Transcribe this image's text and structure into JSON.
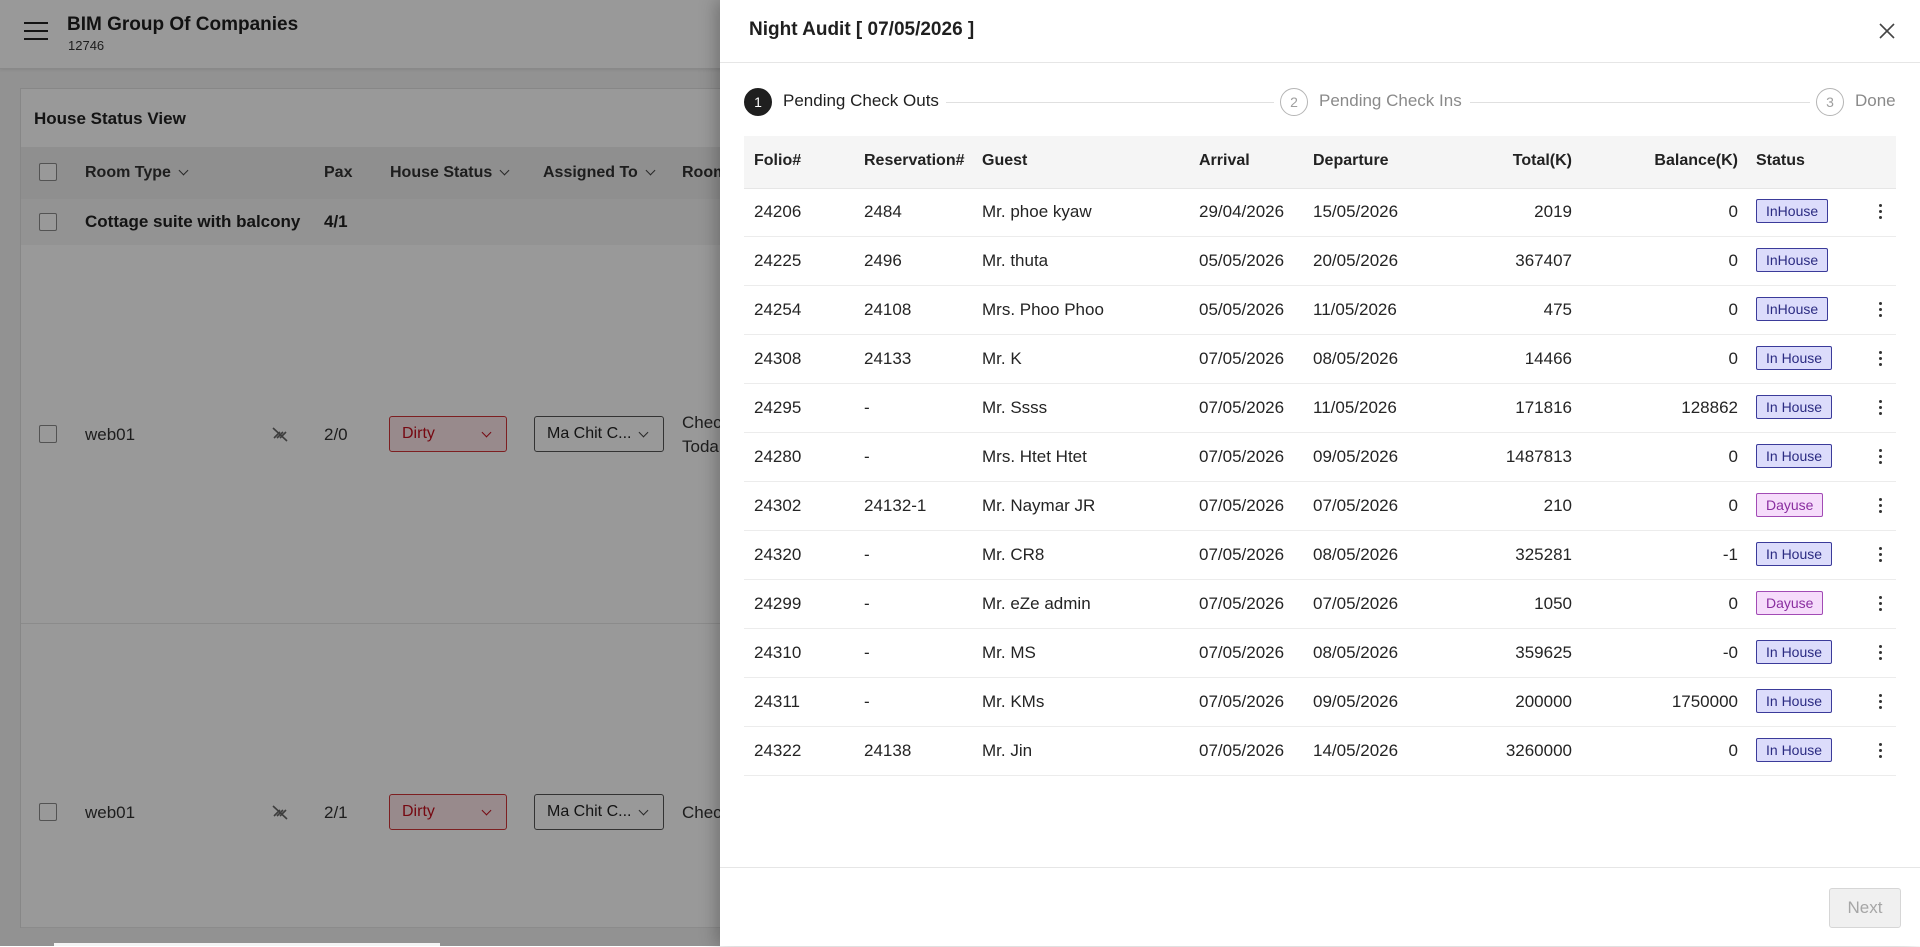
{
  "background_app": {
    "company_name": "BIM Group Of Companies",
    "company_code": "12746",
    "panel_title": "House Status View",
    "columns": {
      "room_type": "Room Type",
      "pax": "Pax",
      "house_status": "House Status",
      "assigned_to": "Assigned To",
      "room": "Room"
    },
    "group": {
      "room_type": "Cottage suite with balcony",
      "pax": "4/1"
    },
    "rows": [
      {
        "room": "web01",
        "pax": "2/0",
        "status": "Dirty",
        "assigned": "Ma Chit C...",
        "note_line1": "Chec",
        "note_line2": "Toda"
      },
      {
        "room": "web01",
        "pax": "2/1",
        "status": "Dirty",
        "assigned": "Ma Chit C...",
        "note_line1": "Chec",
        "note_line2": ""
      }
    ]
  },
  "drawer": {
    "title": "Night Audit [ 07/05/2026 ]",
    "steps": [
      {
        "number": "1",
        "label": "Pending Check Outs"
      },
      {
        "number": "2",
        "label": "Pending Check Ins"
      },
      {
        "number": "3",
        "label": "Done"
      }
    ],
    "table": {
      "headers": {
        "folio": "Folio#",
        "reservation": "Reservation#",
        "guest": "Guest",
        "arrival": "Arrival",
        "departure": "Departure",
        "total": "Total(K)",
        "balance": "Balance(K)",
        "status": "Status"
      },
      "rows": [
        {
          "folio": "24206",
          "reservation": "2484",
          "guest": "Mr. phoe kyaw",
          "arrival": "29/04/2026",
          "departure": "15/05/2026",
          "total": "2019",
          "balance": "0",
          "status": "InHouse",
          "type": "inhouse"
        },
        {
          "folio": "24225",
          "reservation": "2496",
          "guest": "Mr. thuta",
          "arrival": "05/05/2026",
          "departure": "20/05/2026",
          "total": "367407",
          "balance": "0",
          "status": "InHouse",
          "type": "inhouse"
        },
        {
          "folio": "24254",
          "reservation": "24108",
          "guest": "Mrs. Phoo Phoo",
          "arrival": "05/05/2026",
          "departure": "11/05/2026",
          "total": "475",
          "balance": "0",
          "status": "InHouse",
          "type": "inhouse"
        },
        {
          "folio": "24308",
          "reservation": "24133",
          "guest": "Mr. K",
          "arrival": "07/05/2026",
          "departure": "08/05/2026",
          "total": "14466",
          "balance": "0",
          "status": "In House",
          "type": "inhouse"
        },
        {
          "folio": "24295",
          "reservation": "-",
          "guest": "Mr. Ssss",
          "arrival": "07/05/2026",
          "departure": "11/05/2026",
          "total": "171816",
          "balance": "128862",
          "status": "In House",
          "type": "inhouse"
        },
        {
          "folio": "24280",
          "reservation": "-",
          "guest": "Mrs. Htet Htet",
          "arrival": "07/05/2026",
          "departure": "09/05/2026",
          "total": "1487813",
          "balance": "0",
          "status": "In House",
          "type": "inhouse"
        },
        {
          "folio": "24302",
          "reservation": "24132-1",
          "guest": "Mr. Naymar JR",
          "arrival": "07/05/2026",
          "departure": "07/05/2026",
          "total": "210",
          "balance": "0",
          "status": "Dayuse",
          "type": "dayuse"
        },
        {
          "folio": "24320",
          "reservation": "-",
          "guest": "Mr. CR8",
          "arrival": "07/05/2026",
          "departure": "08/05/2026",
          "total": "325281",
          "balance": "-1",
          "status": "In House",
          "type": "inhouse"
        },
        {
          "folio": "24299",
          "reservation": "-",
          "guest": "Mr. eZe admin",
          "arrival": "07/05/2026",
          "departure": "07/05/2026",
          "total": "1050",
          "balance": "0",
          "status": "Dayuse",
          "type": "dayuse"
        },
        {
          "folio": "24310",
          "reservation": "-",
          "guest": "Mr. MS",
          "arrival": "07/05/2026",
          "departure": "08/05/2026",
          "total": "359625",
          "balance": "-0",
          "status": "In House",
          "type": "inhouse"
        },
        {
          "folio": "24311",
          "reservation": "-",
          "guest": "Mr. KMs",
          "arrival": "07/05/2026",
          "departure": "09/05/2026",
          "total": "200000",
          "balance": "1750000",
          "status": "In House",
          "type": "inhouse"
        },
        {
          "folio": "24322",
          "reservation": "24138",
          "guest": "Mr. Jin",
          "arrival": "07/05/2026",
          "departure": "14/05/2026",
          "total": "3260000",
          "balance": "0",
          "status": "In House",
          "type": "inhouse"
        }
      ]
    },
    "next_label": "Next"
  }
}
